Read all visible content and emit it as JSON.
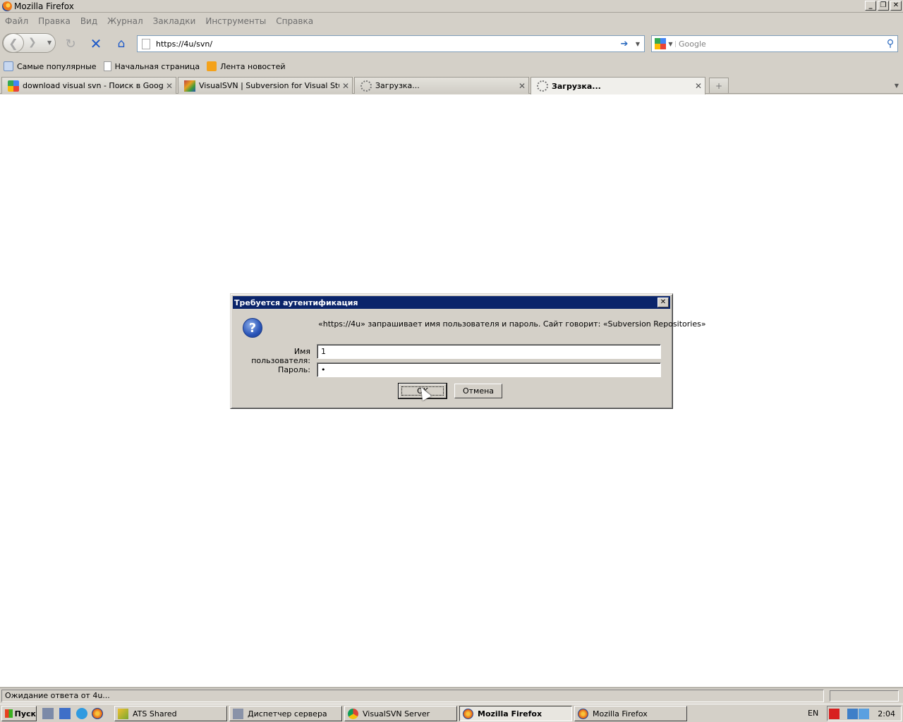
{
  "window": {
    "title": "Mozilla Firefox"
  },
  "menu": [
    "Файл",
    "Правка",
    "Вид",
    "Журнал",
    "Закладки",
    "Инструменты",
    "Справка"
  ],
  "nav": {
    "url": "https://4u/svn/",
    "search_placeholder": "Google"
  },
  "bookmarks": [
    "Самые популярные",
    "Начальная страница",
    "Лента новостей"
  ],
  "tabs": [
    {
      "label": "download visual svn - Поиск в Google",
      "icon": "google-icon"
    },
    {
      "label": "VisualSVN | Subversion for Visual Studio",
      "icon": "visualsvn-icon"
    },
    {
      "label": "Загрузка...",
      "icon": "loading-icon"
    },
    {
      "label": "Загрузка...",
      "icon": "loading-icon",
      "active": true
    }
  ],
  "dialog": {
    "title": "Требуется аутентификация",
    "message": "«https://4u» запрашивает имя пользователя и пароль. Сайт говорит: «Subversion Repositories»",
    "username_label": "Имя пользователя:",
    "username_value": "1",
    "password_label": "Пароль:",
    "password_value": "•",
    "ok_label": "OK",
    "cancel_label": "Отмена"
  },
  "status": {
    "text": "Ожидание ответа от 4u..."
  },
  "taskbar": {
    "start_label": "Пуск",
    "items": [
      "ATS Shared",
      "Диспетчер сервера",
      "VisualSVN Server",
      "Mozilla Firefox",
      "Mozilla Firefox"
    ],
    "lang": "EN",
    "clock": "2:04"
  }
}
